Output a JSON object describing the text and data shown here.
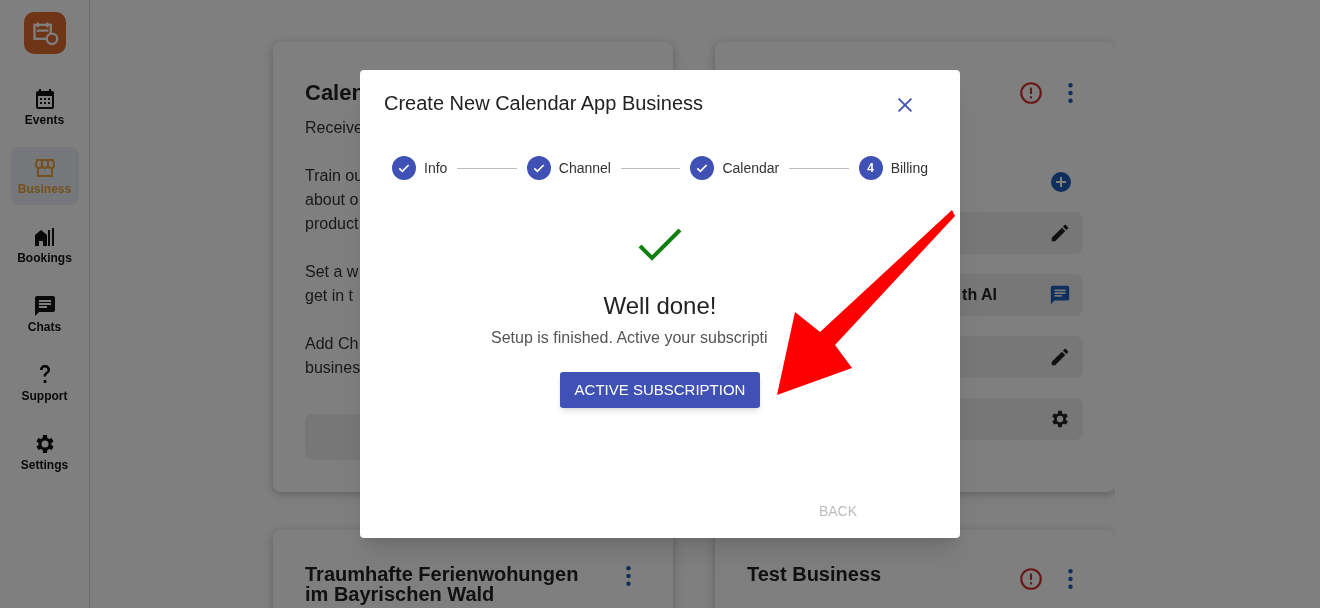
{
  "sidebar": {
    "items": [
      {
        "label": "Events",
        "selected": false
      },
      {
        "label": "Business",
        "selected": true
      },
      {
        "label": "Bookings",
        "selected": false
      },
      {
        "label": "Chats",
        "selected": false
      },
      {
        "label": "Support",
        "selected": false
      },
      {
        "label": "Settings",
        "selected": false
      }
    ]
  },
  "cards": [
    {
      "title": "Calen",
      "paragraphs": [
        [
          "Receive"
        ],
        [
          "Train ou",
          "about o",
          "product"
        ],
        [
          "Set a w",
          "get in t"
        ],
        [
          "Add Ch",
          "busines"
        ]
      ]
    },
    {
      "alert": true,
      "rows": [
        {
          "kind": "add"
        },
        {
          "kind": "edit"
        },
        {
          "kind": "chat",
          "label": "th AI"
        },
        {
          "kind": "edit"
        },
        {
          "kind": "settings"
        }
      ]
    },
    {
      "title": "Traumhafte Ferienwohungen im Bayrischen Wald",
      "alert": false
    },
    {
      "title": "Test Business",
      "alert": true
    }
  ],
  "dialog": {
    "title": "Create New Calendar App Business",
    "steps": [
      {
        "label": "Info",
        "completed": true
      },
      {
        "label": "Channel",
        "completed": true
      },
      {
        "label": "Calendar",
        "completed": true
      },
      {
        "label": "Billing",
        "completed": false,
        "number": "4"
      }
    ],
    "heading": "Well done!",
    "message": "Setup is finished. Active your subscripti",
    "primary_button": "ACTIVE SUBSCRIPTION",
    "back_button": {
      "label": "BACK",
      "disabled": true
    }
  }
}
